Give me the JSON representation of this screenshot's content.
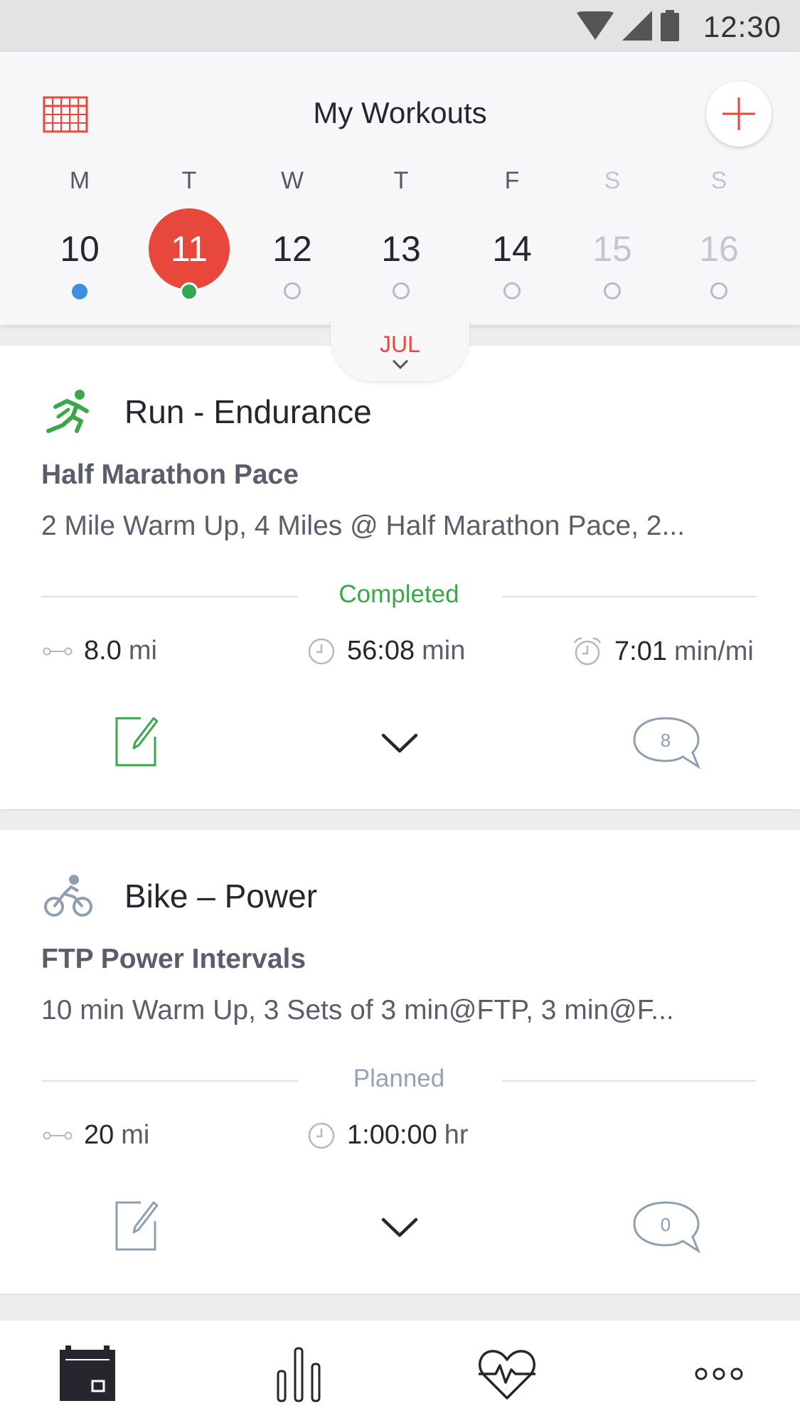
{
  "status_bar": {
    "time": "12:30"
  },
  "header": {
    "title": "My Workouts",
    "month": "JUL",
    "days": [
      {
        "letter": "M",
        "num": "10"
      },
      {
        "letter": "T",
        "num": "11"
      },
      {
        "letter": "W",
        "num": "12"
      },
      {
        "letter": "T",
        "num": "13"
      },
      {
        "letter": "F",
        "num": "14"
      },
      {
        "letter": "S",
        "num": "15"
      },
      {
        "letter": "S",
        "num": "16"
      }
    ]
  },
  "workouts": [
    {
      "sport": "Run - Endurance",
      "name": "Half Marathon Pace",
      "description": "2 Mile Warm Up, 4 Miles @ Half Marathon Pace, 2...",
      "status": "Completed",
      "distance": {
        "value": "8.0",
        "unit": "mi"
      },
      "duration": {
        "value": "56:08",
        "unit": "min"
      },
      "pace": {
        "value": "7:01",
        "unit": "min/mi"
      },
      "comments": "8"
    },
    {
      "sport": "Bike – Power",
      "name": "FTP Power Intervals",
      "description": "10 min Warm Up, 3 Sets of 3 min@FTP, 3 min@F...",
      "status": "Planned",
      "distance": {
        "value": "20",
        "unit": "mi"
      },
      "duration": {
        "value": "1:00:00",
        "unit": "hr"
      },
      "comments": "0"
    }
  ],
  "colors": {
    "accent_red": "#e8483b",
    "completed_green": "#3aa848",
    "planned_gray": "#93a4b2",
    "dot_blue": "#3d8fe0",
    "dot_green": "#34a853"
  },
  "icons": {
    "header": [
      "calendar-grid-icon",
      "plus-icon"
    ],
    "run_card": [
      "running-icon",
      "distance-icon",
      "clock-icon",
      "alarm-clock-icon",
      "edit-note-icon",
      "chevron-down-icon",
      "comment-bubble-icon"
    ],
    "bike_card": [
      "cycling-icon",
      "distance-icon",
      "clock-icon",
      "edit-note-icon",
      "chevron-down-icon",
      "comment-bubble-icon"
    ],
    "tab_bar": [
      "calendar-tab-icon",
      "bar-chart-tab-icon",
      "heart-rate-tab-icon",
      "more-dots-tab-icon"
    ]
  }
}
